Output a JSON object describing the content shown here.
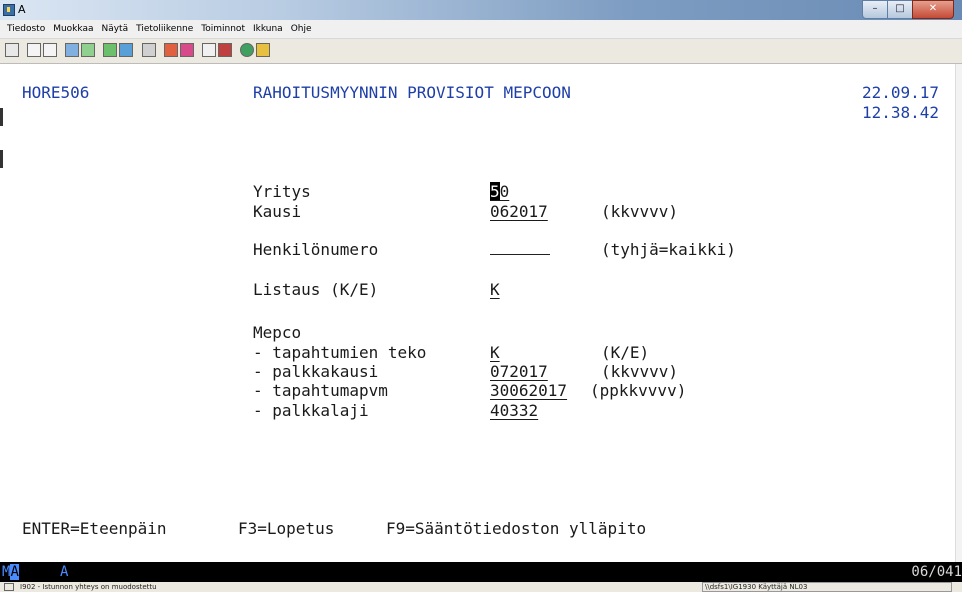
{
  "window": {
    "title": "A",
    "min_label": "–",
    "max_label": "□",
    "close_label": "✕"
  },
  "menu": {
    "items": [
      "Tiedosto",
      "Muokkaa",
      "Näytä",
      "Tietoliikenne",
      "Toiminnot",
      "Ikkuna",
      "Ohje"
    ]
  },
  "toolbar": {
    "icons": [
      "screen-icon",
      "copy-icon",
      "paste-icon",
      "send-icon",
      "receive-icon",
      "keyboard-icon",
      "display-icon",
      "print-icon",
      "color-icon",
      "palette-icon",
      "macro-play-icon",
      "macro-record-icon",
      "globe-icon",
      "edit-icon"
    ]
  },
  "screen": {
    "program_id": "HORE506",
    "title": "RAHOITUSMYYNNIN PROVISIOT MEPCOON",
    "date": "22.09.17",
    "time": "12.38.42",
    "fields": {
      "yritys": {
        "label": "Yritys",
        "value_first": "5",
        "value_rest": "0"
      },
      "kausi": {
        "label": "Kausi",
        "value": "062017",
        "hint": "(kkvvvv)"
      },
      "henkilonumero": {
        "label": "Henkilönumero",
        "value": "",
        "hint": "(tyhjä=kaikki)"
      },
      "listaus": {
        "label": "Listaus (K/E)",
        "value": "K"
      },
      "mepco": {
        "label": "Mepco"
      },
      "tapahtumien_teko": {
        "label": "- tapahtumien teko",
        "value": "K",
        "hint": "(K/E)"
      },
      "palkkakausi": {
        "label": "- palkkakausi",
        "value": "072017",
        "hint": "(kkvvvv)"
      },
      "tapahtumapvm": {
        "label": "- tapahtumapvm",
        "value": "30062017",
        "hint": "(ppkkvvvv)"
      },
      "palkkalaji": {
        "label": "- palkkalaji",
        "value": "40332"
      }
    },
    "function_keys": {
      "enter": "ENTER=Eteenpäin",
      "f3": "F3=Lopetus",
      "f9": "F9=Sääntötiedoston ylläpito"
    }
  },
  "status": {
    "mode_prefix": "M",
    "mode_highlight": "A",
    "session": "A",
    "position": "06/041"
  },
  "infobar": {
    "left": "I902 - Istunnon yhteys on muodostettu",
    "right": "\\\\dsfs1\\IG1930 Käyttäjä NL03"
  },
  "colors": {
    "terminal_bg": "#ffffff",
    "field_text": "#1f3fa8",
    "status_bg": "#000000",
    "status_accent": "#4a8cff"
  }
}
